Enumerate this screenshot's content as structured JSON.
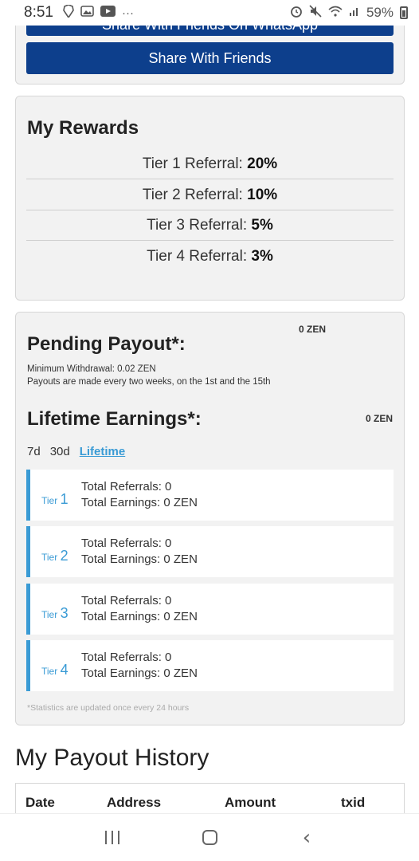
{
  "status_bar": {
    "time": "8:51",
    "battery": "59%",
    "left_icons": [
      "brave-icon",
      "image-icon",
      "youtube-icon",
      "more-icon"
    ],
    "right_icons": [
      "alarm-icon",
      "mute-icon",
      "wifi-icon",
      "signal-icon",
      "battery-icon"
    ]
  },
  "share": {
    "top_button_label": "Share With Friends On WhatsApp",
    "main_button_label": "Share With Friends"
  },
  "rewards": {
    "title": "My Rewards",
    "rows": [
      {
        "label": "Tier 1 Referral:",
        "value": "20%"
      },
      {
        "label": "Tier 2 Referral:",
        "value": "10%"
      },
      {
        "label": "Tier 3 Referral:",
        "value": "5%"
      },
      {
        "label": "Tier 4 Referral:",
        "value": "3%"
      }
    ]
  },
  "earnings": {
    "pending_title": "Pending Payout*:",
    "pending_amount": "0 ZEN",
    "min_withdrawal": "Minimum Withdrawal: 0.02 ZEN",
    "payout_schedule": "Payouts are made every two weeks, on the 1st and the 15th",
    "lifetime_title": "Lifetime Earnings*:",
    "lifetime_amount": "0 ZEN",
    "periods": [
      "7d",
      "30d",
      "Lifetime"
    ],
    "active_period": "Lifetime",
    "tiers": [
      {
        "tier_word": "Tier",
        "num": "1",
        "referrals": "Total Referrals: 0",
        "earnings": "Total Earnings: 0 ZEN"
      },
      {
        "tier_word": "Tier",
        "num": "2",
        "referrals": "Total Referrals: 0",
        "earnings": "Total Earnings: 0 ZEN"
      },
      {
        "tier_word": "Tier",
        "num": "3",
        "referrals": "Total Referrals: 0",
        "earnings": "Total Earnings: 0 ZEN"
      },
      {
        "tier_word": "Tier",
        "num": "4",
        "referrals": "Total Referrals: 0",
        "earnings": "Total Earnings: 0 ZEN"
      }
    ],
    "stats_note": "*Statistics are updated once every 24 hours"
  },
  "history": {
    "title": "My Payout History",
    "columns": [
      "Date",
      "Address",
      "Amount",
      "txid"
    ]
  },
  "colors": {
    "accent": "#3a9bd5",
    "button": "#0d3f8c",
    "card_bg": "#f2f2f2"
  }
}
